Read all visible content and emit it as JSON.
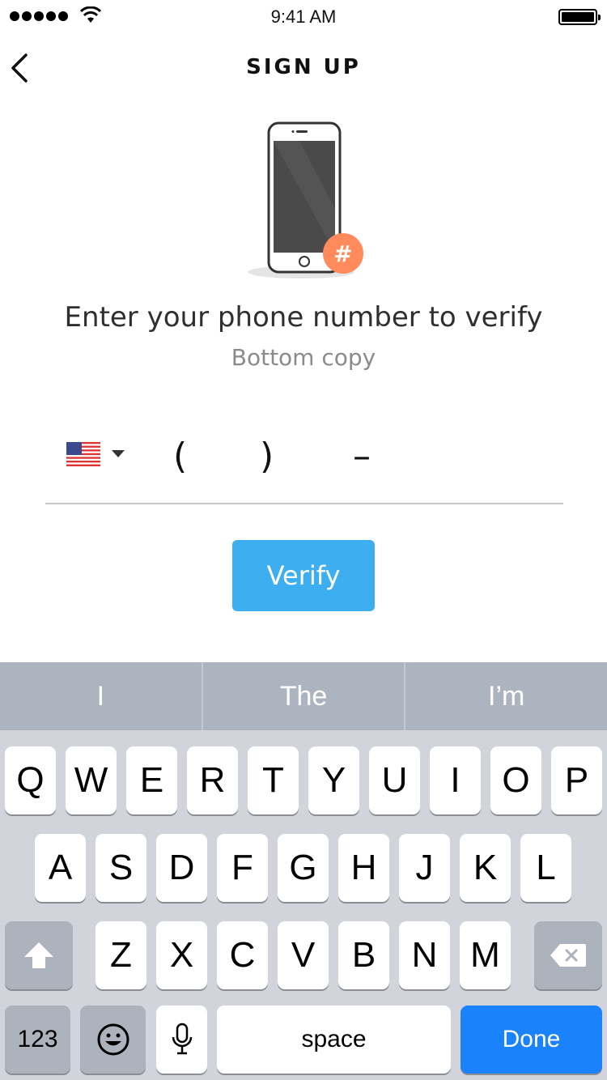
{
  "status_bar": {
    "time": "9:41 AM"
  },
  "nav": {
    "title": "SIGN UP"
  },
  "illustration": {
    "badge": "#"
  },
  "headline": "Enter your phone number to verify",
  "subcopy": "Bottom copy",
  "phone": {
    "paren_open": "(",
    "paren_close": ")",
    "dash": "–"
  },
  "verify_label": "Verify",
  "keyboard": {
    "suggestions": [
      "I",
      "The",
      "I’m"
    ],
    "row1": [
      "Q",
      "W",
      "E",
      "R",
      "T",
      "Y",
      "U",
      "I",
      "O",
      "P"
    ],
    "row2": [
      "A",
      "S",
      "D",
      "F",
      "G",
      "H",
      "J",
      "K",
      "L"
    ],
    "row3": [
      "Z",
      "X",
      "C",
      "V",
      "B",
      "N",
      "M"
    ],
    "numbers_label": "123",
    "space_label": "space",
    "done_label": "Done"
  },
  "colors": {
    "accent": "#3daef0",
    "done": "#1a82fb",
    "badge": "#ff8a5c"
  }
}
